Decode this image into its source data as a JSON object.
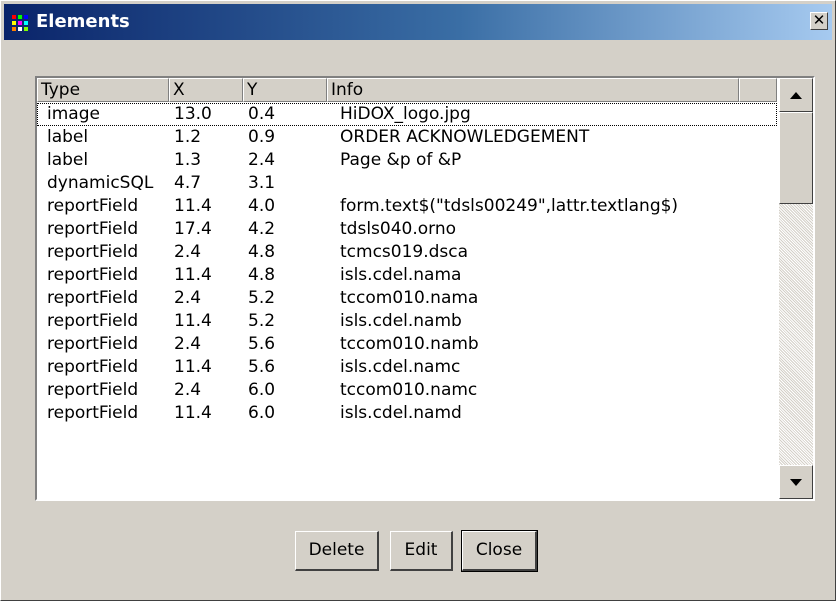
{
  "window": {
    "title": "Elements",
    "close_glyph": "✕"
  },
  "table": {
    "columns": [
      "Type",
      "X",
      "Y",
      "Info"
    ],
    "rows": [
      {
        "type": "image",
        "x": "13.0",
        "y": "0.4",
        "info": "HiDOX_logo.jpg"
      },
      {
        "type": "label",
        "x": "1.2",
        "y": "0.9",
        "info": "ORDER ACKNOWLEDGEMENT"
      },
      {
        "type": "label",
        "x": "1.3",
        "y": "2.4",
        "info": "Page &p of &P"
      },
      {
        "type": "dynamicSQL",
        "x": "4.7",
        "y": "3.1",
        "info": ""
      },
      {
        "type": "reportField",
        "x": "11.4",
        "y": "4.0",
        "info": "form.text$(\"tdsls00249\",lattr.textlang$)"
      },
      {
        "type": "reportField",
        "x": "17.4",
        "y": "4.2",
        "info": "tdsls040.orno"
      },
      {
        "type": "reportField",
        "x": "2.4",
        "y": "4.8",
        "info": "tcmcs019.dsca"
      },
      {
        "type": "reportField",
        "x": "11.4",
        "y": "4.8",
        "info": "isls.cdel.nama"
      },
      {
        "type": "reportField",
        "x": "2.4",
        "y": "5.2",
        "info": "tccom010.nama"
      },
      {
        "type": "reportField",
        "x": "11.4",
        "y": "5.2",
        "info": "isls.cdel.namb"
      },
      {
        "type": "reportField",
        "x": "2.4",
        "y": "5.6",
        "info": "tccom010.namb"
      },
      {
        "type": "reportField",
        "x": "11.4",
        "y": "5.6",
        "info": "isls.cdel.namc"
      },
      {
        "type": "reportField",
        "x": "2.4",
        "y": "6.0",
        "info": "tccom010.namc"
      },
      {
        "type": "reportField",
        "x": "11.4",
        "y": "6.0",
        "info": "isls.cdel.namd"
      }
    ]
  },
  "buttons": {
    "delete": "Delete",
    "edit": "Edit",
    "close": "Close"
  },
  "colors": {
    "titlebar_start": "#0a246a",
    "titlebar_end": "#a6caf0",
    "face": "#d4d0c8"
  }
}
